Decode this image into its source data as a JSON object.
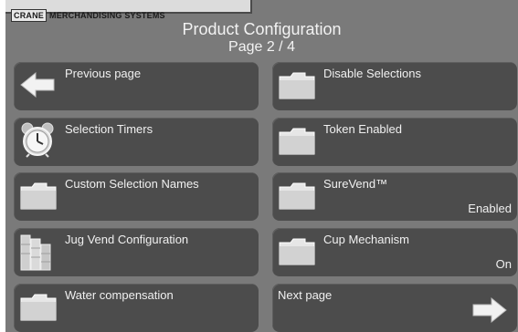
{
  "header": {
    "brand_box": "CRANE",
    "brand_text": "MERCHANDISING SYSTEMS",
    "title": "Product Configuration",
    "page": "Page 2 / 4"
  },
  "tiles": {
    "previous": {
      "label": "Previous page",
      "icon": "arrow-left-icon"
    },
    "selection_timers": {
      "label": "Selection Timers",
      "icon": "alarm-clock-icon"
    },
    "custom_names": {
      "label": "Custom Selection Names",
      "icon": "folder-icon"
    },
    "jug_vend": {
      "label": "Jug Vend Configuration",
      "icon": "jugs-icon"
    },
    "water_comp": {
      "label": "Water compensation",
      "icon": "folder-icon"
    },
    "disable_selections": {
      "label": "Disable Selections",
      "icon": "folder-icon"
    },
    "token_enabled": {
      "label": "Token Enabled",
      "icon": "folder-icon"
    },
    "surevend": {
      "label": "SureVend™",
      "status": "Enabled",
      "icon": "folder-icon"
    },
    "cup_mechanism": {
      "label": "Cup Mechanism",
      "status": "On",
      "icon": "folder-icon"
    },
    "next": {
      "label": "Next page",
      "icon": "arrow-right-icon"
    }
  },
  "colors": {
    "screen_bg": "#7a7a7a",
    "tile_bg": "#4c4c4c",
    "text": "#f0f0f0"
  }
}
